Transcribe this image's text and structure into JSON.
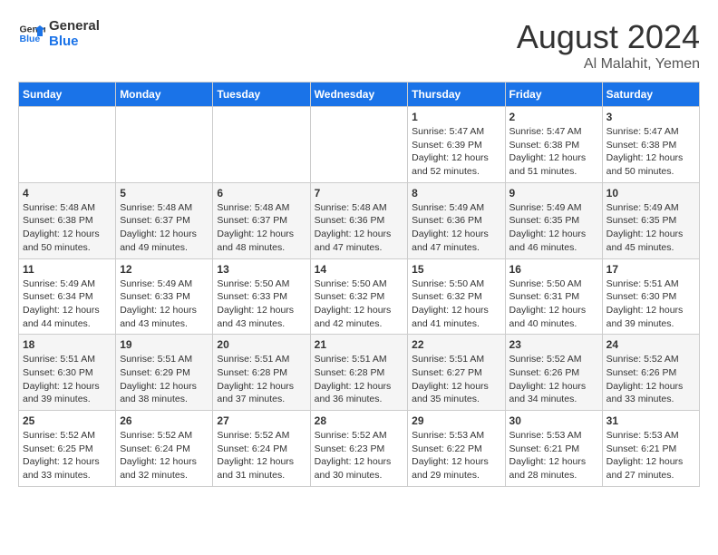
{
  "logo": {
    "line1": "General",
    "line2": "Blue"
  },
  "title": "August 2024",
  "subtitle": "Al Malahit, Yemen",
  "days_of_week": [
    "Sunday",
    "Monday",
    "Tuesday",
    "Wednesday",
    "Thursday",
    "Friday",
    "Saturday"
  ],
  "weeks": [
    [
      {
        "day": "",
        "info": ""
      },
      {
        "day": "",
        "info": ""
      },
      {
        "day": "",
        "info": ""
      },
      {
        "day": "",
        "info": ""
      },
      {
        "day": "1",
        "info": "Sunrise: 5:47 AM\nSunset: 6:39 PM\nDaylight: 12 hours\nand 52 minutes."
      },
      {
        "day": "2",
        "info": "Sunrise: 5:47 AM\nSunset: 6:38 PM\nDaylight: 12 hours\nand 51 minutes."
      },
      {
        "day": "3",
        "info": "Sunrise: 5:47 AM\nSunset: 6:38 PM\nDaylight: 12 hours\nand 50 minutes."
      }
    ],
    [
      {
        "day": "4",
        "info": "Sunrise: 5:48 AM\nSunset: 6:38 PM\nDaylight: 12 hours\nand 50 minutes."
      },
      {
        "day": "5",
        "info": "Sunrise: 5:48 AM\nSunset: 6:37 PM\nDaylight: 12 hours\nand 49 minutes."
      },
      {
        "day": "6",
        "info": "Sunrise: 5:48 AM\nSunset: 6:37 PM\nDaylight: 12 hours\nand 48 minutes."
      },
      {
        "day": "7",
        "info": "Sunrise: 5:48 AM\nSunset: 6:36 PM\nDaylight: 12 hours\nand 47 minutes."
      },
      {
        "day": "8",
        "info": "Sunrise: 5:49 AM\nSunset: 6:36 PM\nDaylight: 12 hours\nand 47 minutes."
      },
      {
        "day": "9",
        "info": "Sunrise: 5:49 AM\nSunset: 6:35 PM\nDaylight: 12 hours\nand 46 minutes."
      },
      {
        "day": "10",
        "info": "Sunrise: 5:49 AM\nSunset: 6:35 PM\nDaylight: 12 hours\nand 45 minutes."
      }
    ],
    [
      {
        "day": "11",
        "info": "Sunrise: 5:49 AM\nSunset: 6:34 PM\nDaylight: 12 hours\nand 44 minutes."
      },
      {
        "day": "12",
        "info": "Sunrise: 5:49 AM\nSunset: 6:33 PM\nDaylight: 12 hours\nand 43 minutes."
      },
      {
        "day": "13",
        "info": "Sunrise: 5:50 AM\nSunset: 6:33 PM\nDaylight: 12 hours\nand 43 minutes."
      },
      {
        "day": "14",
        "info": "Sunrise: 5:50 AM\nSunset: 6:32 PM\nDaylight: 12 hours\nand 42 minutes."
      },
      {
        "day": "15",
        "info": "Sunrise: 5:50 AM\nSunset: 6:32 PM\nDaylight: 12 hours\nand 41 minutes."
      },
      {
        "day": "16",
        "info": "Sunrise: 5:50 AM\nSunset: 6:31 PM\nDaylight: 12 hours\nand 40 minutes."
      },
      {
        "day": "17",
        "info": "Sunrise: 5:51 AM\nSunset: 6:30 PM\nDaylight: 12 hours\nand 39 minutes."
      }
    ],
    [
      {
        "day": "18",
        "info": "Sunrise: 5:51 AM\nSunset: 6:30 PM\nDaylight: 12 hours\nand 39 minutes."
      },
      {
        "day": "19",
        "info": "Sunrise: 5:51 AM\nSunset: 6:29 PM\nDaylight: 12 hours\nand 38 minutes."
      },
      {
        "day": "20",
        "info": "Sunrise: 5:51 AM\nSunset: 6:28 PM\nDaylight: 12 hours\nand 37 minutes."
      },
      {
        "day": "21",
        "info": "Sunrise: 5:51 AM\nSunset: 6:28 PM\nDaylight: 12 hours\nand 36 minutes."
      },
      {
        "day": "22",
        "info": "Sunrise: 5:51 AM\nSunset: 6:27 PM\nDaylight: 12 hours\nand 35 minutes."
      },
      {
        "day": "23",
        "info": "Sunrise: 5:52 AM\nSunset: 6:26 PM\nDaylight: 12 hours\nand 34 minutes."
      },
      {
        "day": "24",
        "info": "Sunrise: 5:52 AM\nSunset: 6:26 PM\nDaylight: 12 hours\nand 33 minutes."
      }
    ],
    [
      {
        "day": "25",
        "info": "Sunrise: 5:52 AM\nSunset: 6:25 PM\nDaylight: 12 hours\nand 33 minutes."
      },
      {
        "day": "26",
        "info": "Sunrise: 5:52 AM\nSunset: 6:24 PM\nDaylight: 12 hours\nand 32 minutes."
      },
      {
        "day": "27",
        "info": "Sunrise: 5:52 AM\nSunset: 6:24 PM\nDaylight: 12 hours\nand 31 minutes."
      },
      {
        "day": "28",
        "info": "Sunrise: 5:52 AM\nSunset: 6:23 PM\nDaylight: 12 hours\nand 30 minutes."
      },
      {
        "day": "29",
        "info": "Sunrise: 5:53 AM\nSunset: 6:22 PM\nDaylight: 12 hours\nand 29 minutes."
      },
      {
        "day": "30",
        "info": "Sunrise: 5:53 AM\nSunset: 6:21 PM\nDaylight: 12 hours\nand 28 minutes."
      },
      {
        "day": "31",
        "info": "Sunrise: 5:53 AM\nSunset: 6:21 PM\nDaylight: 12 hours\nand 27 minutes."
      }
    ]
  ]
}
